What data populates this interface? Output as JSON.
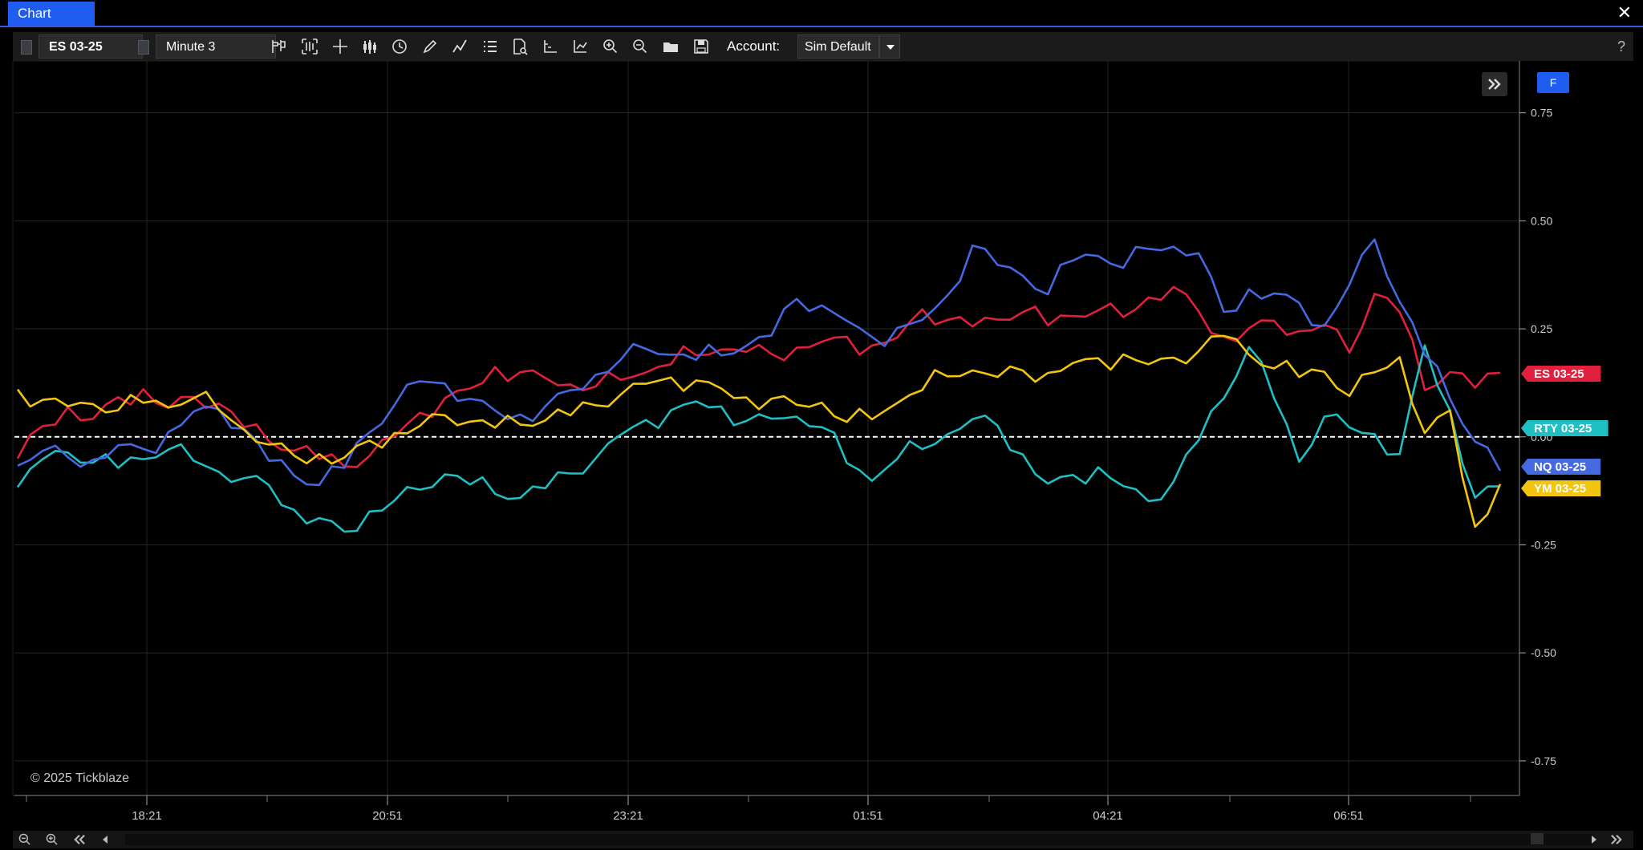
{
  "window": {
    "title": "Chart",
    "close": "✕"
  },
  "toolbar": {
    "instrument": "ES 03-25",
    "timeframe": "Minute 3",
    "account_label": "Account:",
    "account_value": "Sim Default",
    "help": "?"
  },
  "chart": {
    "copyright": "© 2025 Tickblaze",
    "f_button": "F"
  },
  "chart_data": {
    "type": "line",
    "x_ticks": [
      "18:21",
      "20:51",
      "23:21",
      "01:51",
      "04:21",
      "06:51"
    ],
    "y_ticks": [
      "0.75",
      "0.50",
      "0.25",
      "0.00",
      "-0.25",
      "-0.50",
      "-0.75"
    ],
    "ylim": [
      -0.83,
      0.87
    ],
    "baseline": 0.0,
    "grid": true,
    "series": [
      {
        "name": "ES 03-25",
        "color": "#e0203c",
        "last_value": 0.14,
        "values": [
          -0.05,
          0.02,
          0.06,
          0.03,
          0.08,
          0.1,
          0.06,
          0.09,
          0.08,
          0.03,
          0.0,
          -0.02,
          -0.04,
          -0.06,
          -0.04,
          0.0,
          0.05,
          0.08,
          0.1,
          0.15,
          0.14,
          0.13,
          0.12,
          0.12,
          0.14,
          0.16,
          0.18,
          0.2,
          0.21,
          0.2,
          0.19,
          0.2,
          0.21,
          0.22,
          0.2,
          0.22,
          0.29,
          0.27,
          0.26,
          0.28,
          0.3,
          0.27,
          0.29,
          0.3,
          0.28,
          0.32,
          0.34,
          0.28,
          0.22,
          0.24,
          0.26,
          0.24,
          0.26,
          0.2,
          0.34,
          0.3,
          0.12,
          0.16,
          0.12,
          0.15
        ]
      },
      {
        "name": "RTY 03-25",
        "color": "#20bfc4",
        "last_value": 0.02,
        "values": [
          -0.12,
          -0.05,
          -0.03,
          -0.05,
          -0.06,
          -0.04,
          -0.02,
          -0.05,
          -0.08,
          -0.1,
          -0.12,
          -0.18,
          -0.2,
          -0.23,
          -0.18,
          -0.15,
          -0.12,
          -0.08,
          -0.1,
          -0.12,
          -0.13,
          -0.11,
          -0.08,
          -0.05,
          0.0,
          0.03,
          0.05,
          0.07,
          0.06,
          0.03,
          0.04,
          0.05,
          0.03,
          -0.05,
          -0.09,
          -0.04,
          -0.02,
          0.01,
          0.04,
          0.02,
          -0.05,
          -0.12,
          -0.1,
          -0.08,
          -0.12,
          -0.15,
          -0.1,
          0.0,
          0.1,
          0.22,
          0.1,
          -0.05,
          0.05,
          0.02,
          0.0,
          -0.05,
          0.2,
          0.05,
          -0.15,
          -0.12
        ]
      },
      {
        "name": "NQ 03-25",
        "color": "#4668e0",
        "last_value": -0.07,
        "values": [
          -0.06,
          -0.03,
          -0.05,
          -0.06,
          -0.03,
          -0.04,
          0.0,
          0.05,
          0.06,
          0.02,
          -0.05,
          -0.08,
          -0.1,
          -0.06,
          0.02,
          0.08,
          0.13,
          0.12,
          0.08,
          0.05,
          0.04,
          0.06,
          0.1,
          0.14,
          0.18,
          0.21,
          0.2,
          0.19,
          0.2,
          0.22,
          0.24,
          0.32,
          0.3,
          0.26,
          0.22,
          0.24,
          0.26,
          0.32,
          0.44,
          0.4,
          0.38,
          0.34,
          0.42,
          0.43,
          0.4,
          0.44,
          0.44,
          0.42,
          0.28,
          0.33,
          0.32,
          0.3,
          0.25,
          0.35,
          0.46,
          0.32,
          0.2,
          0.1,
          0.0,
          -0.07
        ]
      },
      {
        "name": "YM 03-25",
        "color": "#f2c511",
        "last_value": -0.12,
        "values": [
          0.1,
          0.08,
          0.07,
          0.08,
          0.07,
          0.09,
          0.08,
          0.1,
          0.07,
          0.02,
          -0.02,
          -0.05,
          -0.05,
          -0.06,
          -0.02,
          0.0,
          0.02,
          0.05,
          0.04,
          0.03,
          0.04,
          0.05,
          0.06,
          0.08,
          0.1,
          0.12,
          0.13,
          0.12,
          0.1,
          0.08,
          0.08,
          0.07,
          0.08,
          0.04,
          0.05,
          0.09,
          0.12,
          0.15,
          0.16,
          0.14,
          0.15,
          0.14,
          0.16,
          0.17,
          0.18,
          0.16,
          0.18,
          0.2,
          0.24,
          0.2,
          0.17,
          0.15,
          0.16,
          0.1,
          0.15,
          0.18,
          0.0,
          0.05,
          -0.22,
          -0.12
        ]
      }
    ]
  }
}
